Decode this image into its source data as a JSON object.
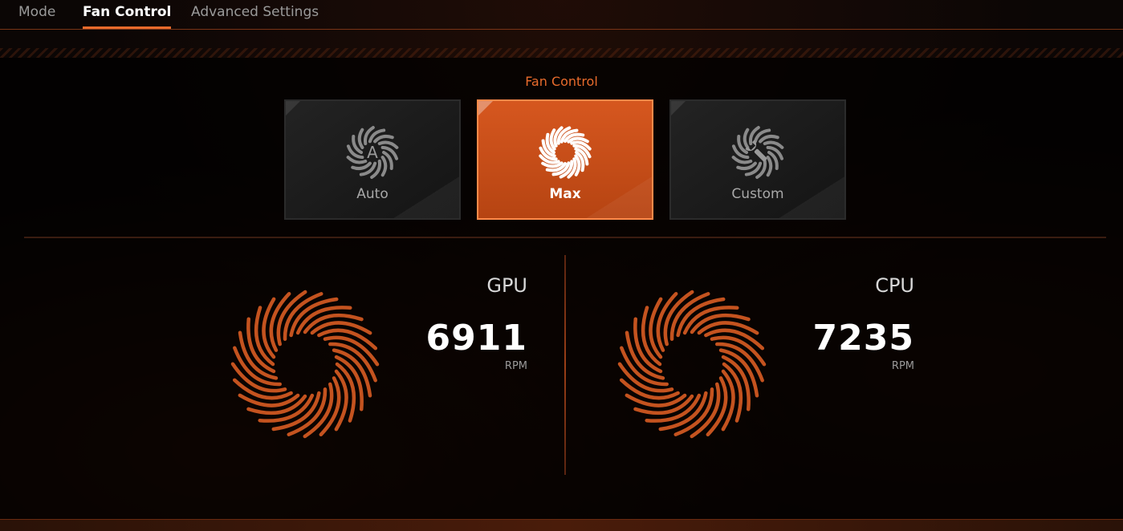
{
  "tabs": [
    {
      "label": "Mode"
    },
    {
      "label": "Fan Control"
    },
    {
      "label": "Advanced Settings"
    }
  ],
  "active_tab": "Fan Control",
  "fan_control": {
    "title": "Fan Control",
    "modes": [
      {
        "label": "Auto",
        "icon": "fan-auto-icon"
      },
      {
        "label": "Max",
        "icon": "fan-max-icon"
      },
      {
        "label": "Custom",
        "icon": "fan-custom-icon"
      }
    ],
    "selected_mode": "Max"
  },
  "gpu": {
    "label": "GPU",
    "rpm": "6911",
    "unit": "RPM"
  },
  "cpu": {
    "label": "CPU",
    "rpm": "7235",
    "unit": "RPM"
  },
  "colors": {
    "accent": "#e86b2c",
    "card_active": "#c94e18",
    "fan_blade": "#c4531f"
  }
}
